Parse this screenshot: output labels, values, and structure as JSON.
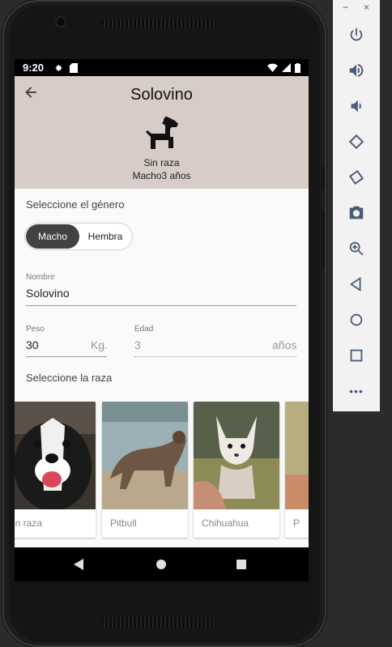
{
  "status_bar": {
    "time": "9:20"
  },
  "header": {
    "title": "Solovino",
    "breed": "Sin raza",
    "sex_age": "Macho3 años"
  },
  "gender": {
    "label": "Seleccione el género",
    "options": [
      "Macho",
      "Hembra"
    ],
    "selected": "Macho"
  },
  "name_field": {
    "caption": "Nombre",
    "value": "Solovino"
  },
  "weight_field": {
    "caption": "Peso",
    "value": "30",
    "unit": "Kg."
  },
  "age_field": {
    "caption": "Edad",
    "value": "3",
    "unit": "años"
  },
  "breed_section": {
    "label": "Seleccione la raza",
    "cards": [
      {
        "name": "Sin raza"
      },
      {
        "name": "Pitbull"
      },
      {
        "name": "Chihuahua"
      },
      {
        "name": "P"
      }
    ]
  },
  "emulator_panel": {
    "window_controls": [
      "−",
      "×"
    ],
    "tools": [
      "power-icon",
      "volume-up-icon",
      "volume-down-icon",
      "rotate-left-icon",
      "rotate-right-icon",
      "camera-icon",
      "zoom-icon",
      "back-icon",
      "home-icon",
      "overview-icon",
      "more-icon"
    ],
    "more_label": "•••"
  },
  "colors": {
    "header_bg": "#d7ccc8",
    "toggle_selected": "#424242"
  }
}
